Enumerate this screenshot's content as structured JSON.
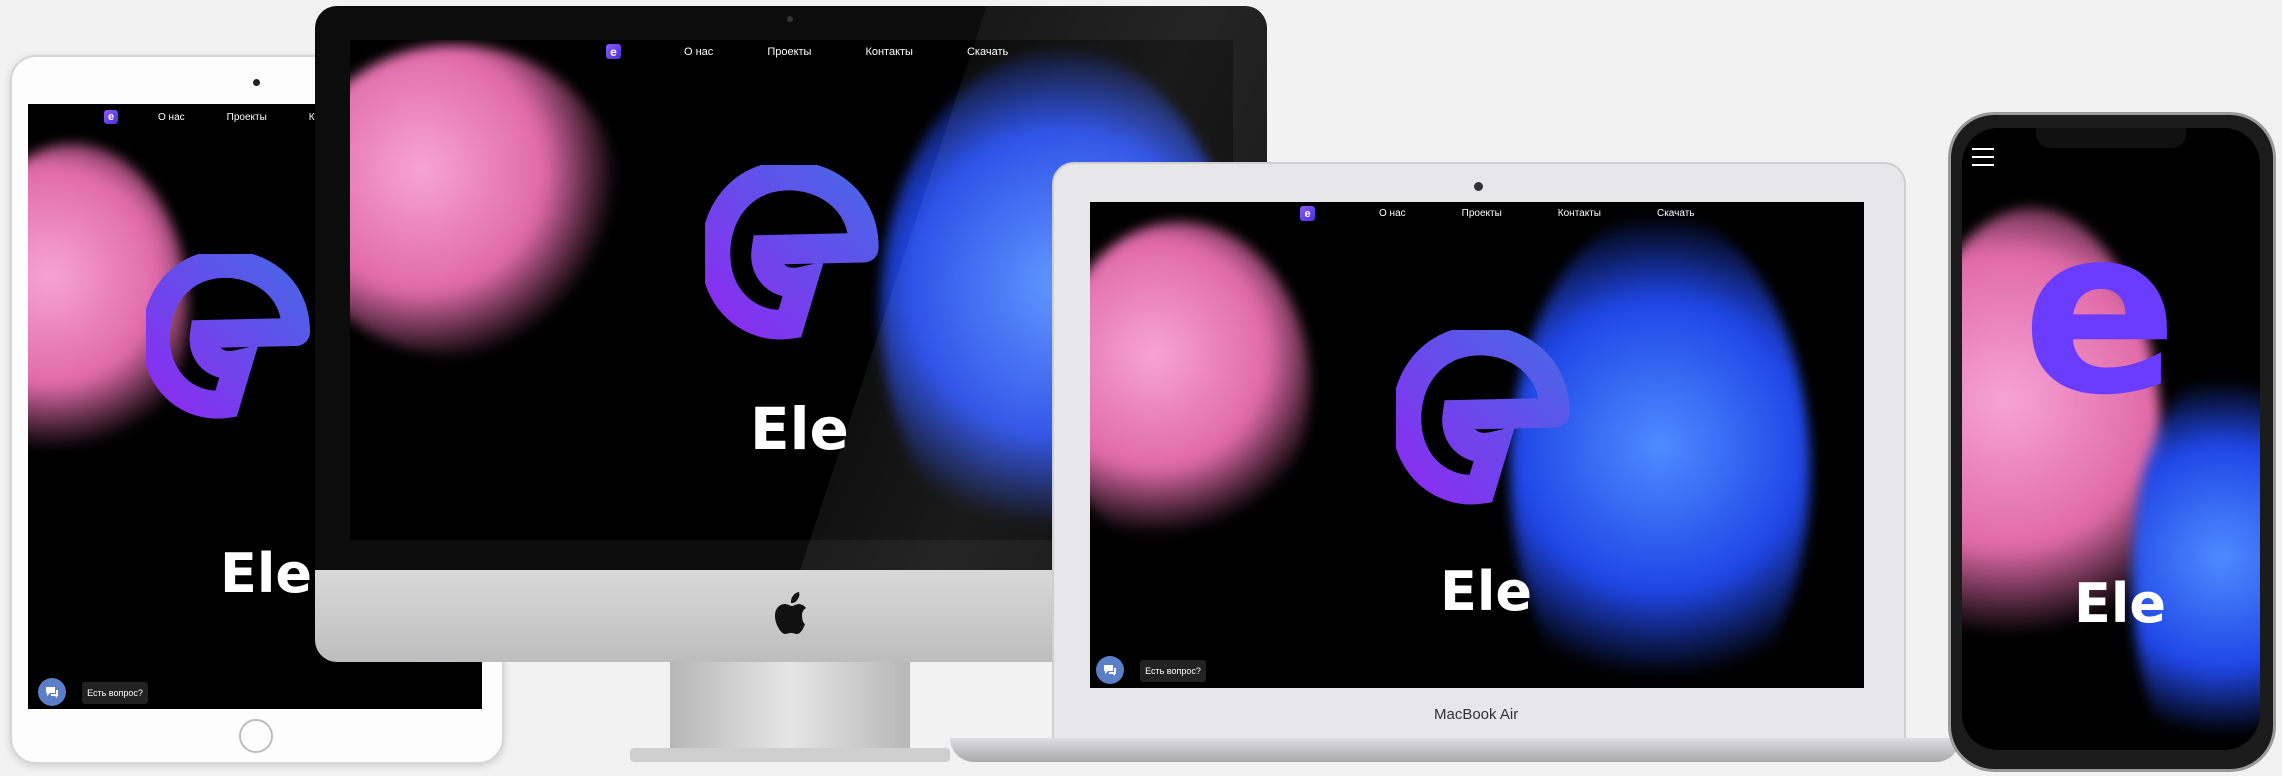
{
  "site": {
    "logo_letter": "e",
    "hero_title": "Ele",
    "nav": [
      "О нас",
      "Проекты",
      "Контакты",
      "Скачать"
    ],
    "chat_label": "Есть вопрос?"
  },
  "laptop": {
    "brand_label": "MacBook Air"
  },
  "colors": {
    "accent": "#6a3cff",
    "pink": "#e06aa8",
    "blue": "#1f46e6",
    "background": "#f2f2f2"
  },
  "icons": [
    "chat-icon",
    "apple-logo-icon",
    "e-logo-icon"
  ]
}
